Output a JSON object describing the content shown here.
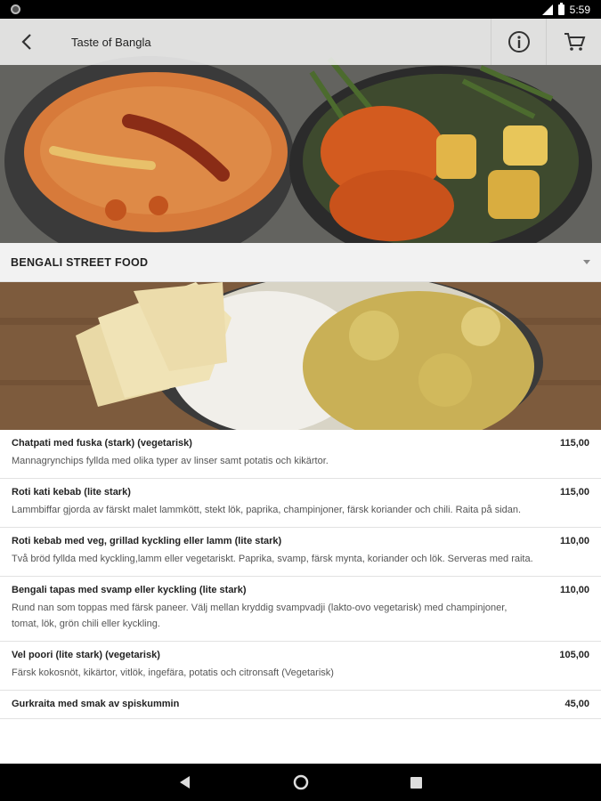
{
  "status_bar": {
    "time": "5:59"
  },
  "app_bar": {
    "title": "Taste of Bangla"
  },
  "category": {
    "title": "BENGALI STREET FOOD"
  },
  "menu": {
    "items": [
      {
        "name": "Chatpati med fuska (stark) (vegetarisk)",
        "price": "115,00",
        "description": "Mannagrynchips fyllda med olika typer av linser samt potatis och kikärtor."
      },
      {
        "name": "Roti kati kebab (lite stark)",
        "price": "115,00",
        "description": "Lammbiffar gjorda av färskt malet lammkött, stekt lök, paprika, champinjoner, färsk koriander och chili. Raita på sidan."
      },
      {
        "name": "Roti kebab med veg, grillad kyckling eller lamm (lite stark)",
        "price": "110,00",
        "description": "Två bröd fyllda med kyckling,lamm eller vegetariskt. Paprika, svamp, färsk mynta, koriander och lök. Serveras med raita."
      },
      {
        "name": "Bengali tapas med svamp eller kyckling (lite stark)",
        "price": "110,00",
        "description": "Rund nan som toppas med färsk paneer. Välj mellan kryddig svampvadji (lakto-ovo vegetarisk) med champinjoner, tomat, lök, grön chili eller kyckling."
      },
      {
        "name": "Vel poori (lite stark) (vegetarisk)",
        "price": "105,00",
        "description": "Färsk kokosnöt, kikärtor, vitlök, ingefära, potatis och citronsaft (Vegetarisk)"
      },
      {
        "name": "Gurkraita med smak av spiskummin",
        "price": "45,00",
        "description": ""
      }
    ]
  },
  "icons": {
    "back": "arrow-back-icon",
    "info": "info-icon",
    "cart": "cart-icon",
    "expand": "chevron-down-icon",
    "nav_back": "nav-back-icon",
    "nav_home": "nav-home-icon",
    "nav_recents": "nav-recents-icon"
  },
  "colors": {
    "app_bar": "#f5f5f5",
    "category_bg": "#f2f2f2",
    "text": "#222222",
    "subtext": "#555555"
  }
}
